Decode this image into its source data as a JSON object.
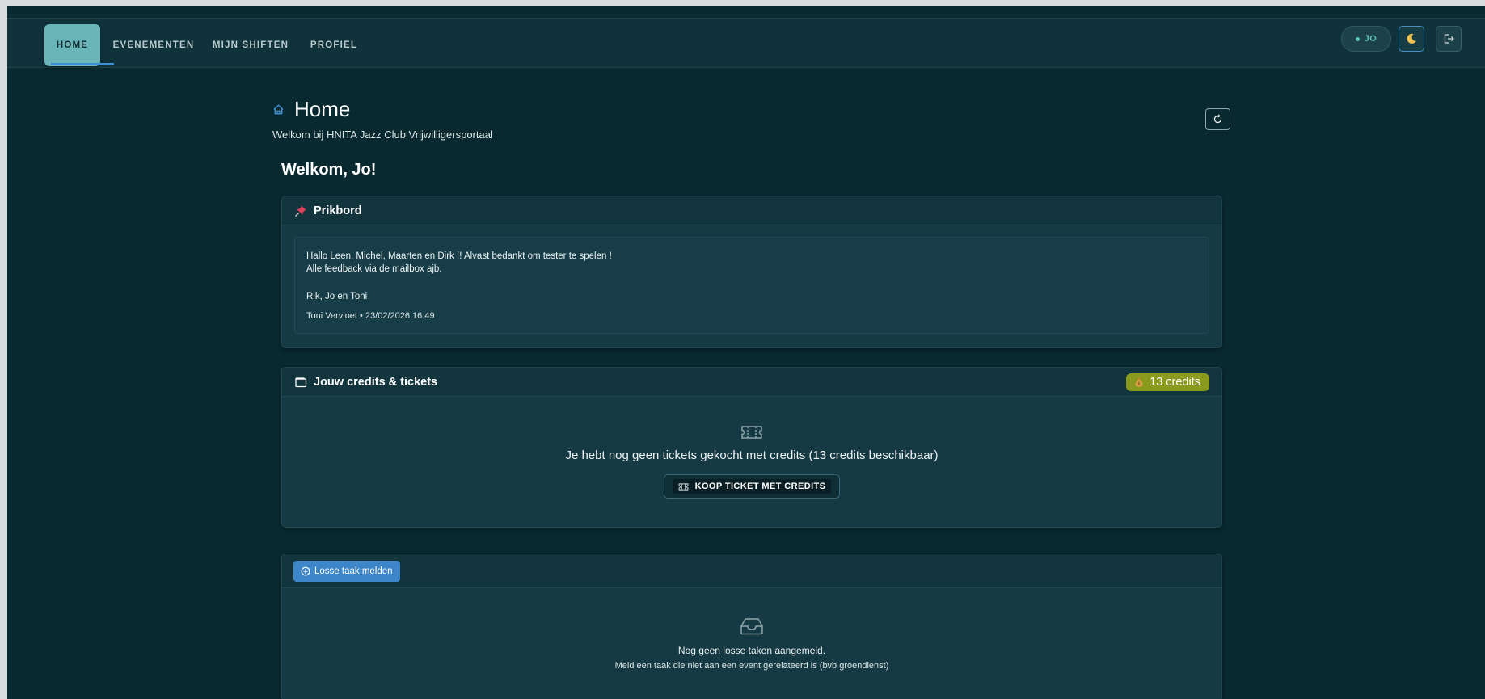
{
  "nav": {
    "items": [
      {
        "label": "HOME",
        "active": true
      },
      {
        "label": "EVENEMENTEN",
        "active": false
      },
      {
        "label": "MIJN SHIFTEN",
        "active": false
      },
      {
        "label": "PROFIEL",
        "active": false
      }
    ],
    "user_initials": "JO",
    "theme_icon": "moon-icon",
    "logout_icon": "logout-icon"
  },
  "header": {
    "title": "Home",
    "subtitle": "Welkom bij HNITA Jazz Club Vrijwilligersportaal",
    "refresh_icon": "refresh-icon"
  },
  "welcome": "Welkom, Jo!",
  "prikbord": {
    "title": "Prikbord",
    "icon": "pushpin-icon",
    "message_line1": "Hallo Leen, Michel, Maarten en Dirk !! Alvast bedankt om tester te spelen !",
    "message_line2": "Alle feedback via de mailbox ajb.",
    "signature": "Rik, Jo en Toni",
    "meta": "Toni Vervloet • 23/02/2026 16:49"
  },
  "credits": {
    "title": "Jouw credits & tickets",
    "badge": "13 credits",
    "empty_message": "Je hebt nog geen tickets gekocht met credits (13 credits beschikbaar)",
    "buy_label": "KOOP TICKET MET CREDITS"
  },
  "tasks": {
    "add_label": "Losse taak melden",
    "empty_title": "Nog geen losse taken aangemeld.",
    "empty_hint": "Meld een taak die niet aan een event gerelateerd is (bvb groendienst)"
  },
  "colors": {
    "background": "#08292f",
    "card": "#153a44",
    "active_tab": "#6ab5b8",
    "accent_blue": "#3d86c9",
    "badge": "#8a9a1d",
    "status_green": "#5bc2b4"
  }
}
